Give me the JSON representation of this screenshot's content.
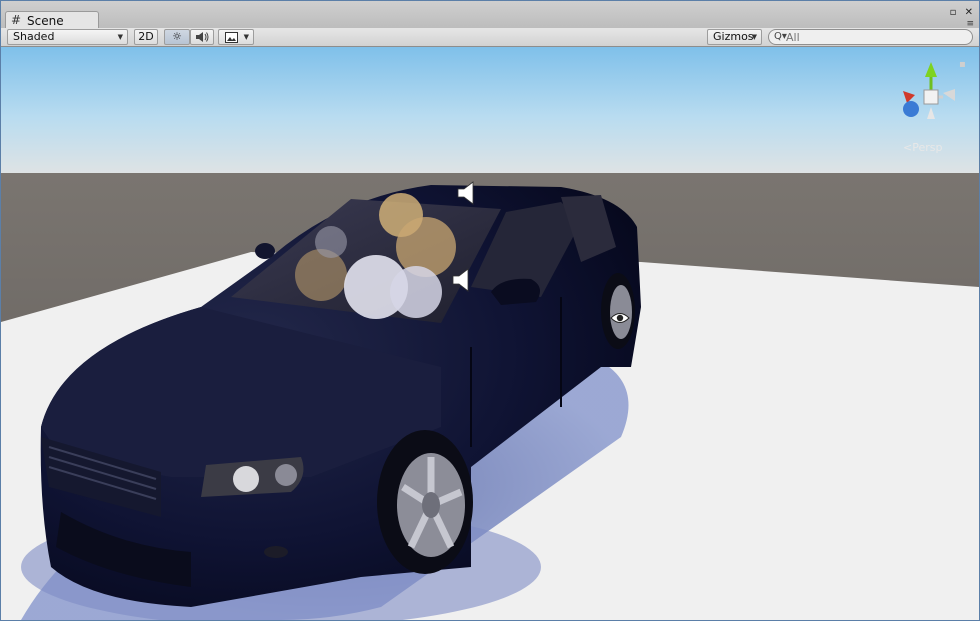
{
  "window": {
    "tab_label": "Scene",
    "tab_icon": "grid-icon"
  },
  "toolbar": {
    "draw_mode": "Shaded",
    "btn_2d": "2D",
    "lighting_icon": "sun-icon",
    "audio_icon": "speaker-icon",
    "effects_icon": "image-icon",
    "gizmos_label": "Gizmos",
    "search_placeholder": "All"
  },
  "scene": {
    "projection_label": "<Persp",
    "sky_color": "#a6d3f0",
    "ground_color": "#5e5a57",
    "plane_color": "#f0f0f0",
    "car_body_color": "#0d1130",
    "gizmo_icons": [
      "speaker-icon",
      "speaker-icon",
      "eye-icon"
    ]
  }
}
